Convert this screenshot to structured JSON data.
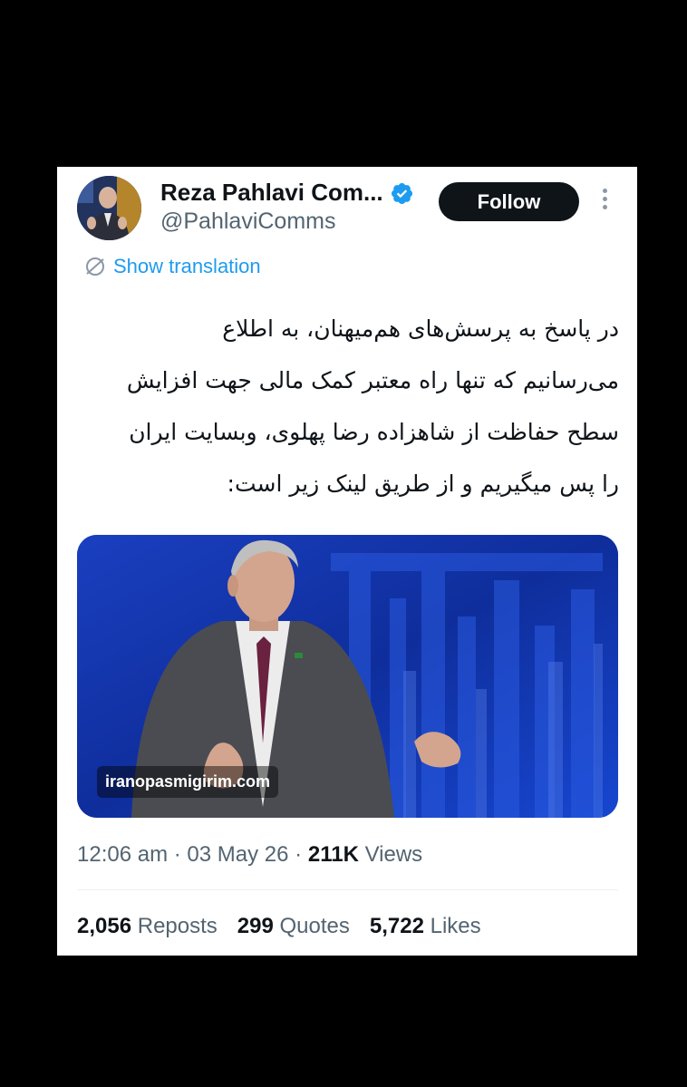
{
  "colors": {
    "accent": "#1d9bf0",
    "background": "#000000",
    "card": "#ffffff",
    "text": "#0f1419",
    "muted": "#536471"
  },
  "author": {
    "name": "Reza Pahlavi Com...",
    "handle": "@PahlaviComms",
    "verified": true,
    "avatar_icon": "avatar-photo"
  },
  "follow_label": "Follow",
  "more_icon": "more-vertical-icon",
  "translate": {
    "label": "Show translation",
    "icon": "globe-translate-icon"
  },
  "tweet": {
    "lines": [
      "در پاسخ به پرسش‌های هم‌میهنان، به اطلاع",
      "می‌رسانیم که تنها راه معتبر کمک مالی جهت افزایش",
      "سطح حفاظت از شاهزاده رضا پهلوی، وبسایت ایران",
      "را پس میگیریم و از طریق لینک زیر است:"
    ]
  },
  "media": {
    "link_label": "iranopasmigirim.com"
  },
  "meta": {
    "time": "12:06 am",
    "date": "03 May 26",
    "views": "211K",
    "views_label": "Views",
    "separator": "·"
  },
  "stats": {
    "reposts": "2,056",
    "reposts_label": "Reposts",
    "quotes": "299",
    "quotes_label": "Quotes",
    "likes": "5,722",
    "likes_label": "Likes"
  }
}
